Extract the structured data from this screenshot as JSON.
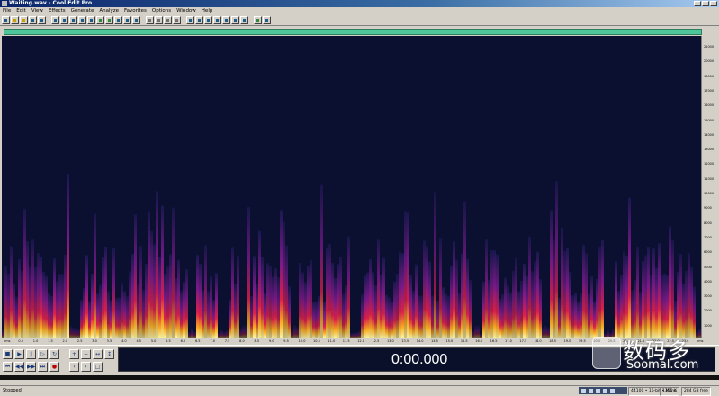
{
  "window": {
    "title": "Waiting.wav - Cool Edit Pro"
  },
  "menu": [
    "File",
    "Edit",
    "View",
    "Effects",
    "Generate",
    "Analyze",
    "Favorites",
    "Options",
    "Window",
    "Help"
  ],
  "freq_ruler": [
    "21000",
    "20000",
    "18000",
    "17000",
    "16000",
    "15000",
    "14000",
    "13000",
    "12000",
    "11000",
    "10000",
    "9000",
    "8000",
    "7000",
    "6000",
    "5000",
    "4000",
    "3000",
    "2000",
    "1000"
  ],
  "time_ruler": [
    "hms",
    "0.5",
    "1.0",
    "1.5",
    "2.0",
    "2.5",
    "3.0",
    "3.5",
    "4.0",
    "4.5",
    "5.0",
    "5.5",
    "6.0",
    "6.5",
    "7.0",
    "7.5",
    "8.0",
    "8.5",
    "9.0",
    "9.5",
    "10.0",
    "10.5",
    "11.0",
    "11.5",
    "12.0",
    "12.5",
    "13.0",
    "13.5",
    "14.0",
    "14.5",
    "15.0",
    "15.5",
    "16.0",
    "16.5",
    "17.0",
    "17.5",
    "18.0",
    "18.5",
    "19.0",
    "19.5",
    "20.0",
    "20.5",
    "21.0",
    "21.5",
    "22.0",
    "22.5",
    "23.0",
    "hms"
  ],
  "time_display": "0:00.000",
  "status": {
    "state": "Stopped",
    "cells": [
      "44100 • 16-bit • Mono",
      "1355 K",
      "284 GB free"
    ]
  },
  "watermark": {
    "cn": "数码多",
    "en": "Soomal.com"
  }
}
